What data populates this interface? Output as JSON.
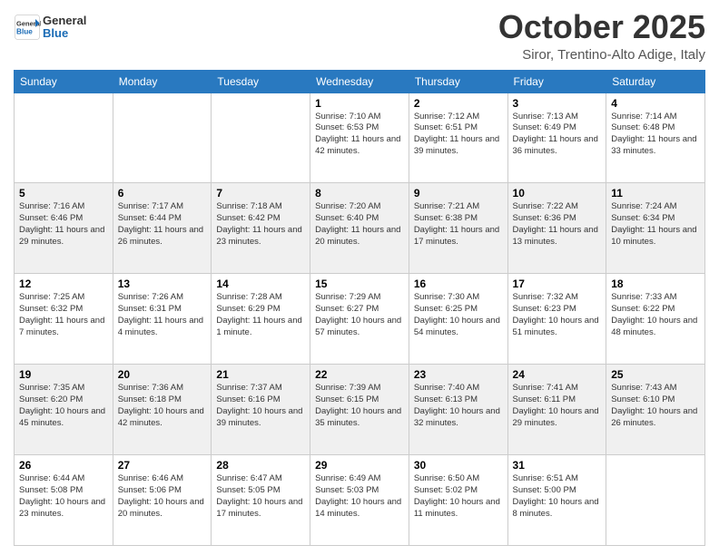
{
  "header": {
    "logo_general": "General",
    "logo_blue": "Blue",
    "month_title": "October 2025",
    "location": "Siror, Trentino-Alto Adige, Italy"
  },
  "days_of_week": [
    "Sunday",
    "Monday",
    "Tuesday",
    "Wednesday",
    "Thursday",
    "Friday",
    "Saturday"
  ],
  "weeks": [
    [
      {
        "day": "",
        "info": ""
      },
      {
        "day": "",
        "info": ""
      },
      {
        "day": "",
        "info": ""
      },
      {
        "day": "1",
        "info": "Sunrise: 7:10 AM\nSunset: 6:53 PM\nDaylight: 11 hours and 42 minutes."
      },
      {
        "day": "2",
        "info": "Sunrise: 7:12 AM\nSunset: 6:51 PM\nDaylight: 11 hours and 39 minutes."
      },
      {
        "day": "3",
        "info": "Sunrise: 7:13 AM\nSunset: 6:49 PM\nDaylight: 11 hours and 36 minutes."
      },
      {
        "day": "4",
        "info": "Sunrise: 7:14 AM\nSunset: 6:48 PM\nDaylight: 11 hours and 33 minutes."
      }
    ],
    [
      {
        "day": "5",
        "info": "Sunrise: 7:16 AM\nSunset: 6:46 PM\nDaylight: 11 hours and 29 minutes."
      },
      {
        "day": "6",
        "info": "Sunrise: 7:17 AM\nSunset: 6:44 PM\nDaylight: 11 hours and 26 minutes."
      },
      {
        "day": "7",
        "info": "Sunrise: 7:18 AM\nSunset: 6:42 PM\nDaylight: 11 hours and 23 minutes."
      },
      {
        "day": "8",
        "info": "Sunrise: 7:20 AM\nSunset: 6:40 PM\nDaylight: 11 hours and 20 minutes."
      },
      {
        "day": "9",
        "info": "Sunrise: 7:21 AM\nSunset: 6:38 PM\nDaylight: 11 hours and 17 minutes."
      },
      {
        "day": "10",
        "info": "Sunrise: 7:22 AM\nSunset: 6:36 PM\nDaylight: 11 hours and 13 minutes."
      },
      {
        "day": "11",
        "info": "Sunrise: 7:24 AM\nSunset: 6:34 PM\nDaylight: 11 hours and 10 minutes."
      }
    ],
    [
      {
        "day": "12",
        "info": "Sunrise: 7:25 AM\nSunset: 6:32 PM\nDaylight: 11 hours and 7 minutes."
      },
      {
        "day": "13",
        "info": "Sunrise: 7:26 AM\nSunset: 6:31 PM\nDaylight: 11 hours and 4 minutes."
      },
      {
        "day": "14",
        "info": "Sunrise: 7:28 AM\nSunset: 6:29 PM\nDaylight: 11 hours and 1 minute."
      },
      {
        "day": "15",
        "info": "Sunrise: 7:29 AM\nSunset: 6:27 PM\nDaylight: 10 hours and 57 minutes."
      },
      {
        "day": "16",
        "info": "Sunrise: 7:30 AM\nSunset: 6:25 PM\nDaylight: 10 hours and 54 minutes."
      },
      {
        "day": "17",
        "info": "Sunrise: 7:32 AM\nSunset: 6:23 PM\nDaylight: 10 hours and 51 minutes."
      },
      {
        "day": "18",
        "info": "Sunrise: 7:33 AM\nSunset: 6:22 PM\nDaylight: 10 hours and 48 minutes."
      }
    ],
    [
      {
        "day": "19",
        "info": "Sunrise: 7:35 AM\nSunset: 6:20 PM\nDaylight: 10 hours and 45 minutes."
      },
      {
        "day": "20",
        "info": "Sunrise: 7:36 AM\nSunset: 6:18 PM\nDaylight: 10 hours and 42 minutes."
      },
      {
        "day": "21",
        "info": "Sunrise: 7:37 AM\nSunset: 6:16 PM\nDaylight: 10 hours and 39 minutes."
      },
      {
        "day": "22",
        "info": "Sunrise: 7:39 AM\nSunset: 6:15 PM\nDaylight: 10 hours and 35 minutes."
      },
      {
        "day": "23",
        "info": "Sunrise: 7:40 AM\nSunset: 6:13 PM\nDaylight: 10 hours and 32 minutes."
      },
      {
        "day": "24",
        "info": "Sunrise: 7:41 AM\nSunset: 6:11 PM\nDaylight: 10 hours and 29 minutes."
      },
      {
        "day": "25",
        "info": "Sunrise: 7:43 AM\nSunset: 6:10 PM\nDaylight: 10 hours and 26 minutes."
      }
    ],
    [
      {
        "day": "26",
        "info": "Sunrise: 6:44 AM\nSunset: 5:08 PM\nDaylight: 10 hours and 23 minutes."
      },
      {
        "day": "27",
        "info": "Sunrise: 6:46 AM\nSunset: 5:06 PM\nDaylight: 10 hours and 20 minutes."
      },
      {
        "day": "28",
        "info": "Sunrise: 6:47 AM\nSunset: 5:05 PM\nDaylight: 10 hours and 17 minutes."
      },
      {
        "day": "29",
        "info": "Sunrise: 6:49 AM\nSunset: 5:03 PM\nDaylight: 10 hours and 14 minutes."
      },
      {
        "day": "30",
        "info": "Sunrise: 6:50 AM\nSunset: 5:02 PM\nDaylight: 10 hours and 11 minutes."
      },
      {
        "day": "31",
        "info": "Sunrise: 6:51 AM\nSunset: 5:00 PM\nDaylight: 10 hours and 8 minutes."
      },
      {
        "day": "",
        "info": ""
      }
    ]
  ]
}
